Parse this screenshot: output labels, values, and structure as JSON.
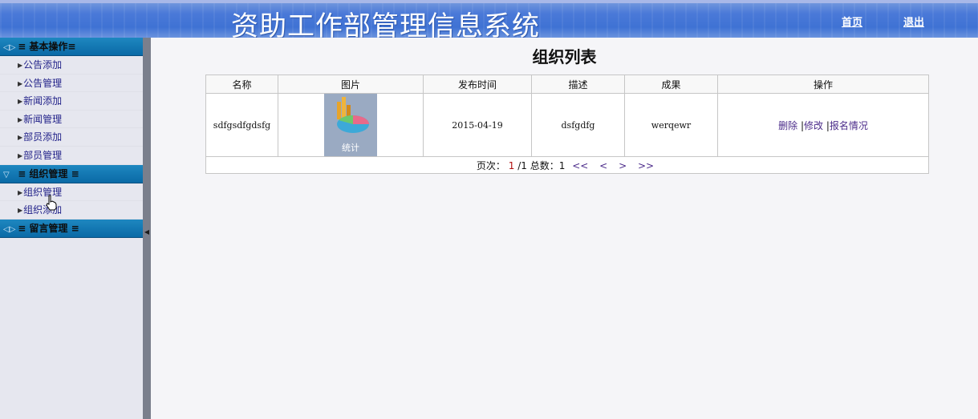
{
  "header": {
    "title": "资助工作部管理信息系统",
    "home_link": "首页",
    "logout_link": "退出"
  },
  "sidebar": {
    "groups": [
      {
        "label": "≡ 基本操作≡",
        "items": [
          "公告添加",
          "公告管理",
          "新闻添加",
          "新闻管理",
          "部员添加",
          "部员管理"
        ]
      },
      {
        "label": "≡ 组织管理 ≡",
        "items": [
          "组织管理",
          "组织添加"
        ]
      },
      {
        "label": "≡ 留言管理 ≡",
        "items": []
      }
    ]
  },
  "main": {
    "title": "组织列表",
    "table": {
      "columns": [
        "名称",
        "图片",
        "发布时间",
        "描述",
        "成果",
        "操作"
      ],
      "rows": [
        {
          "name": "sdfgsdfgdsfg",
          "image_caption": "统计",
          "publish_time": "2015-04-19",
          "description": "dsfgdfg",
          "result": "werqewr",
          "actions": [
            "删除",
            "修改",
            "报名情况"
          ]
        }
      ]
    },
    "pager": {
      "label": "页次：",
      "current": "1",
      "total_pages": "/1",
      "total_label": "总数：",
      "total_count": "1",
      "first": "<<",
      "prev": "<",
      "next": ">",
      "last": ">>"
    }
  },
  "colors": {
    "header_blue": "#4a79d8",
    "sidebar_group": "#0a6aa6",
    "sidebar_bg": "#e6e7ef",
    "link_purple": "#4b2b8a",
    "pager_red": "#b01010"
  }
}
